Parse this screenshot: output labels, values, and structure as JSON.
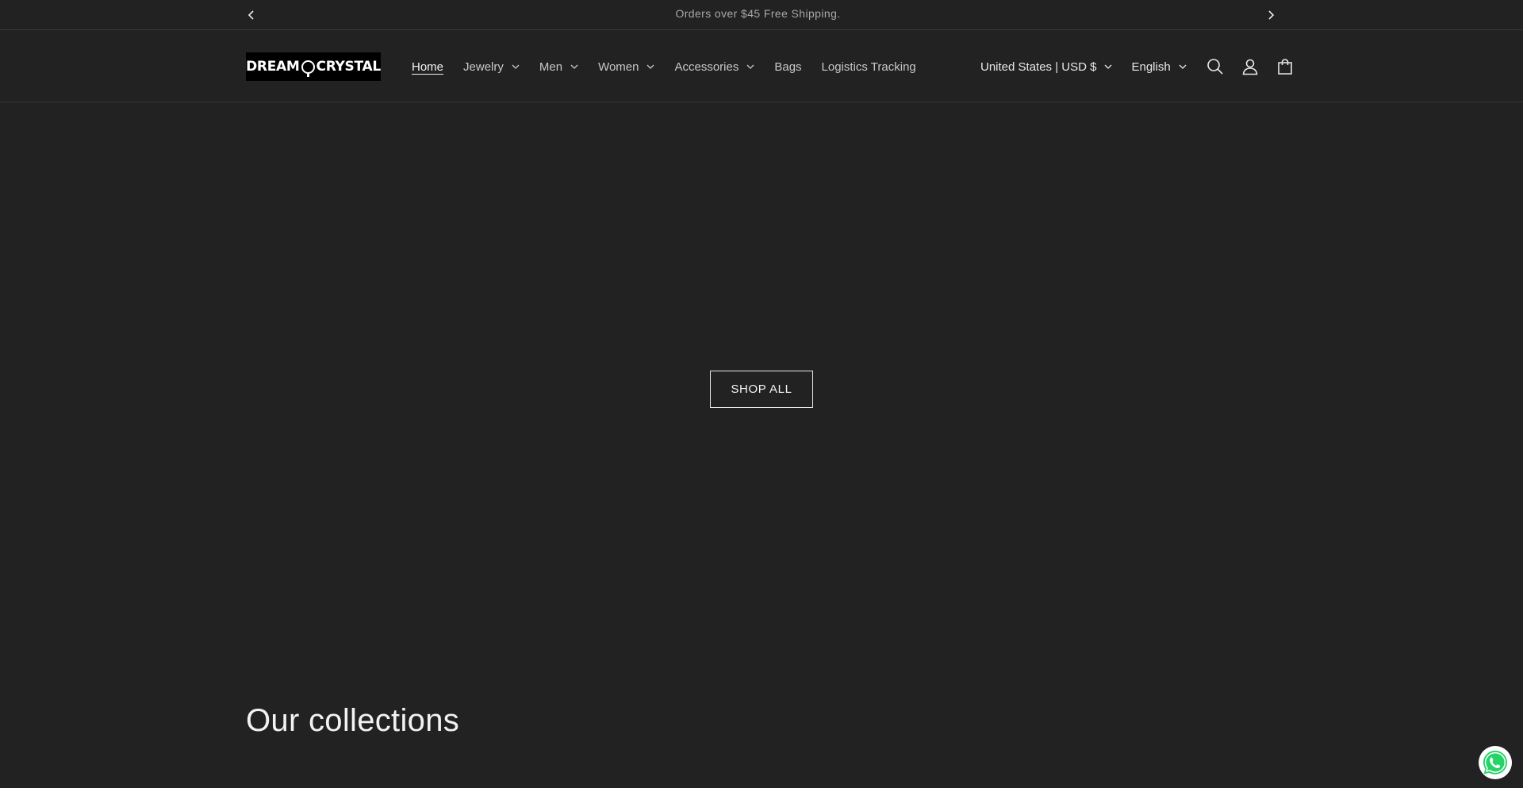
{
  "announcement": {
    "message": "Orders over $45 Free Shipping.",
    "prev_icon": "chevron-left-icon",
    "next_icon": "chevron-right-icon"
  },
  "header": {
    "logo": {
      "part1": "DREAM",
      "part2": "CRYSTAL"
    },
    "nav": [
      {
        "label": "Home",
        "active": true,
        "dropdown": false
      },
      {
        "label": "Jewelry",
        "dropdown": true
      },
      {
        "label": "Men",
        "dropdown": true
      },
      {
        "label": "Women",
        "dropdown": true
      },
      {
        "label": "Accessories",
        "dropdown": true
      },
      {
        "label": "Bags",
        "dropdown": false
      },
      {
        "label": "Logistics Tracking",
        "dropdown": false
      }
    ],
    "country_selector": "United States | USD $",
    "language_selector": "English",
    "icons": [
      "search-icon",
      "account-icon",
      "cart-icon"
    ]
  },
  "hero": {
    "button_label": "SHOP ALL"
  },
  "collections": {
    "title": "Our collections"
  },
  "colors": {
    "background": "#232223",
    "text": "#e8e8e8",
    "muted": "#a9a8a9",
    "border": "#3a393a",
    "whatsapp": "#25d366"
  }
}
